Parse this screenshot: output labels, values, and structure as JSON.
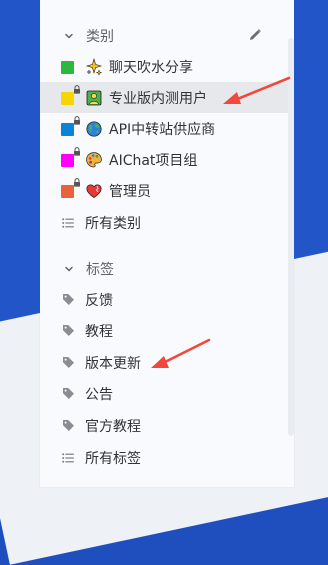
{
  "sidebar": {
    "categories": {
      "title": "类别",
      "items": [
        {
          "label": "聊天吹水分享",
          "color": "#2db83d",
          "icon": "sparkles-icon",
          "locked": false
        },
        {
          "label": "专业版内测用户",
          "color": "#f7d600",
          "icon": "adult-person-icon",
          "locked": true,
          "active": true
        },
        {
          "label": "API中转站供应商",
          "color": "#0b84d8",
          "icon": "globe-icon",
          "locked": true
        },
        {
          "label": "AIChat项目组",
          "color": "#ff00ff",
          "icon": "palette-icon",
          "locked": true
        },
        {
          "label": "管理员",
          "color": "#e8633c",
          "icon": "heart-icon",
          "locked": true
        }
      ],
      "all_label": "所有类别"
    },
    "tags": {
      "title": "标签",
      "items": [
        {
          "label": "反馈"
        },
        {
          "label": "教程"
        },
        {
          "label": "版本更新"
        },
        {
          "label": "公告"
        },
        {
          "label": "官方教程"
        }
      ],
      "all_label": "所有标签"
    }
  },
  "theme": {
    "accent": "#2256c8",
    "panel_bg": "#f8fafd",
    "active_bg": "#e6e8ec",
    "text": "#333333",
    "muted_text": "#5f6368",
    "annotation_arrow": "#f2483b"
  }
}
